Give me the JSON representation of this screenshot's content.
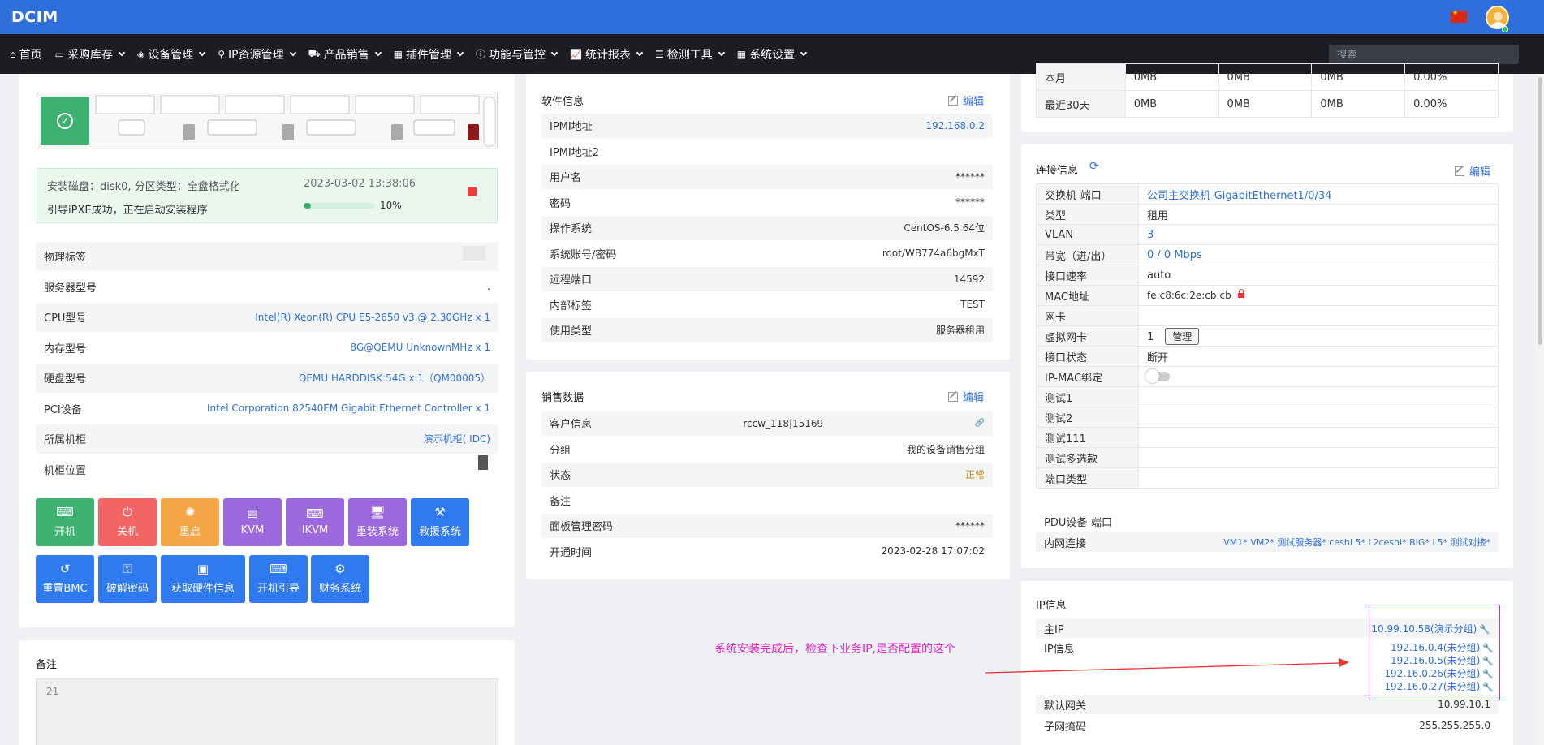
{
  "app": {
    "title": "DCIM"
  },
  "nav": {
    "items": [
      {
        "label": "首页",
        "icon": "home-icon",
        "glyph": "⌂"
      },
      {
        "label": "采购库存",
        "icon": "inbox-icon",
        "glyph": "▭"
      },
      {
        "label": "设备管理",
        "icon": "cube-icon",
        "glyph": "◈"
      },
      {
        "label": "IP资源管理",
        "icon": "location-icon",
        "glyph": "⚲"
      },
      {
        "label": "产品销售",
        "icon": "cart-icon",
        "glyph": "⛟"
      },
      {
        "label": "插件管理",
        "icon": "grid-icon",
        "glyph": "▦"
      },
      {
        "label": "功能与管控",
        "icon": "info-icon",
        "glyph": "ⓘ"
      },
      {
        "label": "统计报表",
        "icon": "chart-icon",
        "glyph": "📈"
      },
      {
        "label": "检测工具",
        "icon": "list-icon",
        "glyph": "☰"
      },
      {
        "label": "系统设置",
        "icon": "apps-icon",
        "glyph": "▦"
      }
    ],
    "search_placeholder": "搜索"
  },
  "install": {
    "disk_line": "安装磁盘：disk0, 分区类型：全盘格式化",
    "timestamp": "2023-03-02 13:38:06",
    "status_line": "引导iPXE成功，正在启动安装程序",
    "progress": 10,
    "progress_label": "10%"
  },
  "hardware": {
    "rows": [
      {
        "label": "物理标签",
        "value": ""
      },
      {
        "label": "服务器型号",
        "value": "."
      },
      {
        "label": "CPU型号",
        "value": "Intel(R) Xeon(R) CPU E5-2650 v3 @ 2.30GHz x 1"
      },
      {
        "label": "内存型号",
        "value": "8G@QEMU UnknownMHz x 1"
      },
      {
        "label": "硬盘型号",
        "value": "QEMU HARDDISK:54G x 1（QM00005）"
      },
      {
        "label": "PCI设备",
        "value": "Intel Corporation 82540EM Gigabit Ethernet Controller x 1"
      },
      {
        "label": "所属机柜",
        "value": "演示机柜(   IDC)"
      },
      {
        "label": "机柜位置",
        "value": ""
      }
    ]
  },
  "actions": {
    "row1": [
      {
        "label": "开机",
        "icon": "power-on-icon",
        "glyph": "⌨"
      },
      {
        "label": "关机",
        "icon": "power-off-icon",
        "glyph": "⏻"
      },
      {
        "label": "重启",
        "icon": "restart-icon",
        "glyph": "✺"
      },
      {
        "label": "KVM",
        "icon": "kvm-icon",
        "glyph": "▤"
      },
      {
        "label": "IKVM",
        "icon": "ikvm-icon",
        "glyph": "⌨"
      },
      {
        "label": "重装系统",
        "icon": "reinstall-icon",
        "glyph": "🖥"
      },
      {
        "label": "救援系统",
        "icon": "rescue-icon",
        "glyph": "⚒"
      }
    ],
    "row2": [
      {
        "label": "重置BMC",
        "icon": "reset-icon",
        "glyph": "↺"
      },
      {
        "label": "破解密码",
        "icon": "key-icon",
        "glyph": "⚿"
      },
      {
        "label": "获取硬件信息",
        "icon": "hardware-icon",
        "glyph": "▣"
      },
      {
        "label": "开机引导",
        "icon": "boot-icon",
        "glyph": "⌨"
      },
      {
        "label": "财务系统",
        "icon": "settings-icon",
        "glyph": "⚙"
      }
    ]
  },
  "notes": {
    "title": "备注",
    "content": "21"
  },
  "software": {
    "title": "软件信息",
    "edit_label": "编辑",
    "rows": [
      {
        "label": "IPMI地址",
        "value": "192.168.0.2"
      },
      {
        "label": "IPMI地址2",
        "value": ""
      },
      {
        "label": "用户名",
        "value": "******"
      },
      {
        "label": "密码",
        "value": "******"
      },
      {
        "label": "操作系统",
        "value": "CentOS-6.5 64位"
      },
      {
        "label": "系统账号/密码",
        "value": "root/WB774a6bgMxT"
      },
      {
        "label": "远程端口",
        "value": "14592"
      },
      {
        "label": "内部标签",
        "value": "TEST"
      },
      {
        "label": "使用类型",
        "value": "服务器租用"
      }
    ]
  },
  "sales": {
    "title": "销售数据",
    "edit_label": "编辑",
    "rows": [
      {
        "label": "客户信息",
        "value": "rccw_118|15169"
      },
      {
        "label": "分组",
        "value": "我的设备销售分组"
      },
      {
        "label": "状态",
        "value": "正常"
      },
      {
        "label": "备注",
        "value": ""
      },
      {
        "label": "面板管理密码",
        "value": "******"
      },
      {
        "label": "开通时间",
        "value": "2023-02-28 17:07:02"
      }
    ]
  },
  "traffic": {
    "rows": [
      {
        "label": "本月",
        "a": "0MB",
        "b": "0MB",
        "c": "0MB",
        "d": "0.00%"
      },
      {
        "label": "最近30天",
        "a": "0MB",
        "b": "0MB",
        "c": "0MB",
        "d": "0.00%"
      }
    ]
  },
  "connection": {
    "title": "连接信息",
    "edit_label": "编辑",
    "switch_port": "公司主交换机-GigabitEthernet1/0/34",
    "type": "租用",
    "vlan": "3",
    "bandwidth": "0 / 0 Mbps",
    "port_rate": "auto",
    "mac": "fe:c8:6c:2e:cb:cb",
    "nic": "",
    "vnic_count": "1",
    "vnic_button": "管理",
    "port_status": "断开",
    "labels": {
      "switch_port": "交换机-端口",
      "type": "类型",
      "vlan": "VLAN",
      "bandwidth": "带宽（进/出）",
      "port_rate": "接口速率",
      "mac": "MAC地址",
      "nic": "网卡",
      "vnic": "虚拟网卡",
      "port_status": "接口状态",
      "ipmac": "IP-MAC绑定",
      "test1": "测试1",
      "test2": "测试2",
      "test111": "测试111",
      "test_multi": "测试多选款",
      "port_type": "端口类型"
    },
    "pdu_label": "PDU设备-端口",
    "intranet_label": "内网连接",
    "intranet_value": "VM1* VM2* 测试服务器* ceshi 5* L2ceshi* BIG* L5* 测试对接*"
  },
  "ipinfo": {
    "title": "IP信息",
    "main_ip_label": "主IP",
    "main_ip": "10.99.10.58(演示分组)",
    "ip_label": "IP信息",
    "ips": [
      "192.16.0.4(未分组)",
      "192.16.0.5(未分组)",
      "192.16.0.26(未分组)",
      "192.16.0.27(未分组)"
    ],
    "gateway_label": "默认网关",
    "gateway": "10.99.10.1",
    "subnet_label": "子网掩码",
    "subnet": "255.255.255.0"
  },
  "annotation": {
    "text": "系统安装完成后，检查下业务IP,是否配置的这个",
    "color": "#e020c0",
    "arrow_color": "#e33"
  },
  "colors": {
    "topbar": "#2f6fdc",
    "navbar": "#1b1d23",
    "link": "#2f6fdc"
  }
}
